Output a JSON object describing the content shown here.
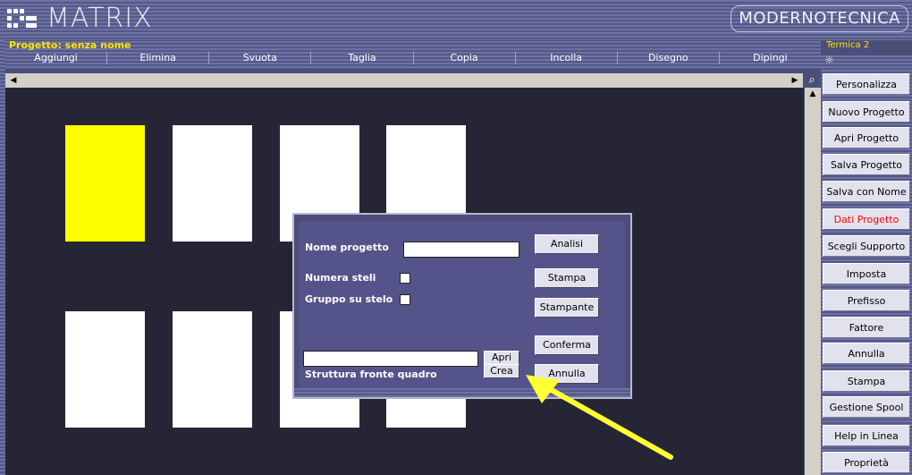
{
  "app": {
    "title": "MATRIX",
    "brand": "MODERNOTECNICA",
    "project_label": "Progetto: senza nome",
    "terminal_label": "Termica 2"
  },
  "menu": {
    "items": [
      "Aggiungi",
      "Elimina",
      "Svuota",
      "Taglia",
      "Copia",
      "Incolla",
      "Disegno",
      "Dipingi"
    ]
  },
  "sidebar": {
    "buttons": [
      {
        "label": "Personalizza"
      },
      {
        "label": "Nuovo Progetto"
      },
      {
        "label": "Apri Progetto"
      },
      {
        "label": "Salva Progetto"
      },
      {
        "label": "Salva con Nome"
      },
      {
        "label": "Dati Progetto",
        "color": "#ff0000"
      },
      {
        "label": "Scegli Supporto"
      },
      {
        "label": "Imposta Carattere"
      },
      {
        "label": "Prefisso"
      },
      {
        "label": "Fattore Ripetizione"
      },
      {
        "label": "Annulla"
      },
      {
        "label": "Stampa"
      },
      {
        "label": "Gestione Spool"
      },
      {
        "label": "Help in Linea"
      },
      {
        "label": "Proprietà"
      }
    ]
  },
  "canvas": {
    "background": "#252536",
    "cards": [
      {
        "color": "#ffff00"
      },
      {
        "color": "#ffffff"
      },
      {
        "color": "#ffffff"
      },
      {
        "color": "#ffffff"
      },
      {
        "color": "#ffffff"
      },
      {
        "color": "#ffffff"
      },
      {
        "color": "#ffffff"
      },
      {
        "color": "#ffffff"
      }
    ]
  },
  "dialog": {
    "nome_progetto_label": "Nome progetto",
    "nome_progetto_value": "",
    "numera_steli_label": "Numera steli",
    "gruppo_su_stelo_label": "Gruppo su stelo",
    "struttura_label": "Struttura fronte quadro",
    "struttura_value": "",
    "btn_apri": "Apri",
    "btn_crea": "Crea",
    "btn_analisi": "Analisi",
    "btn_stampa": "Stampa",
    "btn_stampante": "Stampante",
    "btn_conferma": "Conferma",
    "btn_annulla": "Annulla"
  },
  "colors": {
    "accent_yellow": "#ffe400",
    "arrow": "#ffff33",
    "highlight_red": "#ff0000"
  }
}
